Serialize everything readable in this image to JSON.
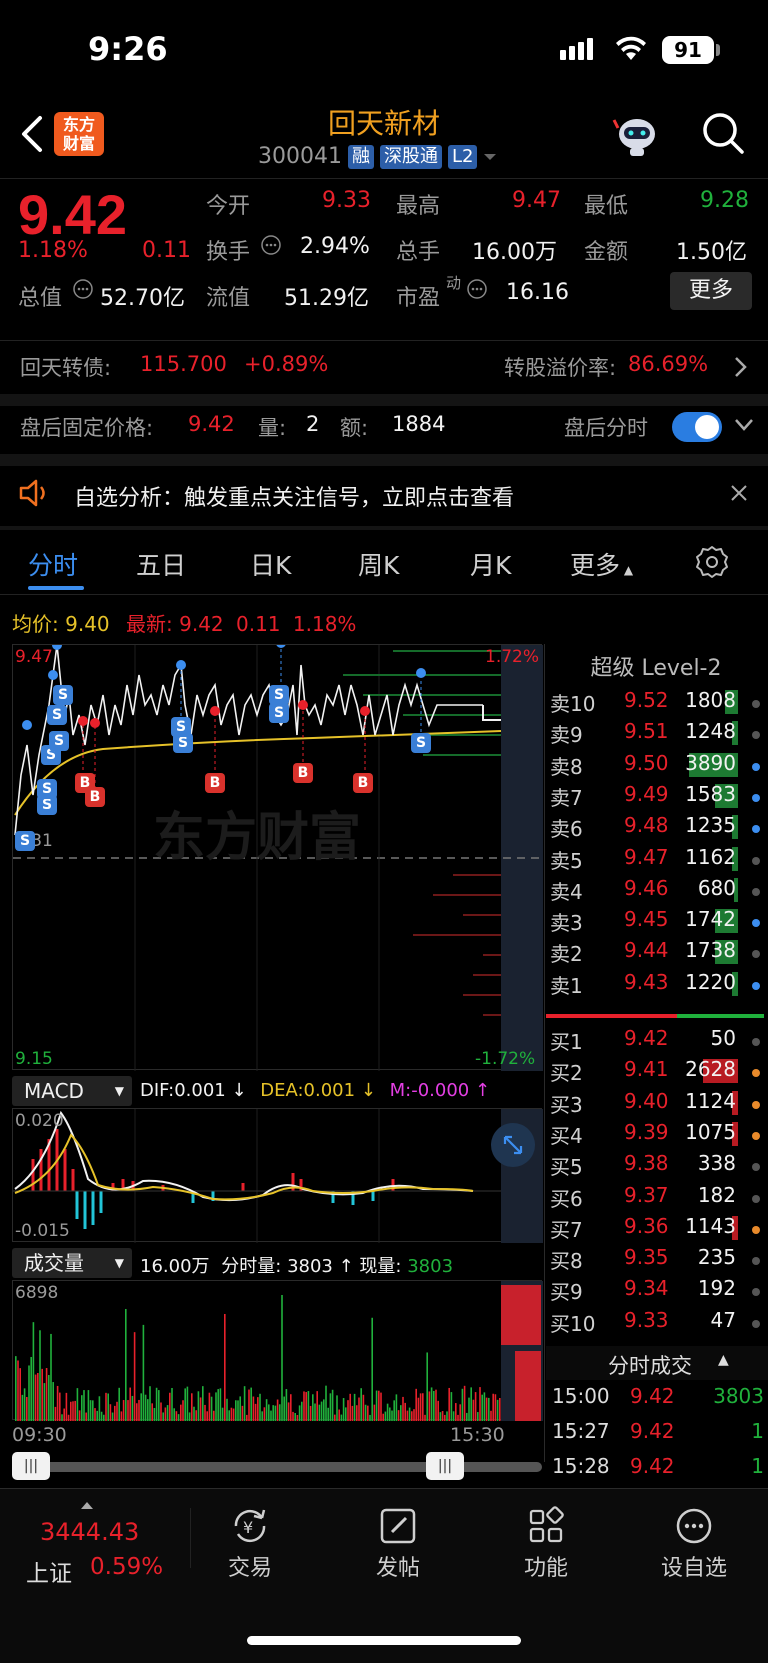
{
  "status": {
    "time": "9:26",
    "battery": "91"
  },
  "header": {
    "title": "回天新材",
    "code": "300041",
    "tags": [
      "融",
      "深股通",
      "L2"
    ],
    "logo_line1": "东方",
    "logo_line2": "财富"
  },
  "quote": {
    "price": "9.42",
    "change_pct": "1.18%",
    "change": "0.11",
    "open_label": "今开",
    "open": "9.33",
    "high_label": "最高",
    "high": "9.47",
    "low_label": "最低",
    "low": "9.28",
    "turnover_label": "换手",
    "turnover": "2.94%",
    "volume_label": "总手",
    "volume": "16.00万",
    "amount_label": "金额",
    "amount": "1.50亿",
    "mktcap_label": "总值",
    "mktcap": "52.70亿",
    "float_label": "流值",
    "float": "51.29亿",
    "pe_label": "市盈",
    "pe_sup": "动",
    "pe": "16.16",
    "more": "更多"
  },
  "bond": {
    "label": "回天转债:",
    "price": "115.700",
    "change": "+0.89%",
    "premium_label": "转股溢价率:",
    "premium": "86.69%"
  },
  "afterhours": {
    "label": "盘后固定价格:",
    "price": "9.42",
    "vol_label": "量:",
    "vol": "2",
    "amt_label": "额:",
    "amt": "1884",
    "toggle_label": "盘后分时",
    "toggle_on": true
  },
  "notice": {
    "text": "自选分析：触发重点关注信号，立即点击查看"
  },
  "tabs": [
    "分时",
    "五日",
    "日K",
    "周K",
    "月K",
    "更多"
  ],
  "intraday": {
    "avg_label": "均价:",
    "avg": "9.40",
    "latest_label": "最新:",
    "latest": "9.42",
    "latest_change": "0.11",
    "latest_pct": "1.18%",
    "y_top": "9.47",
    "y_mid": "9.31",
    "y_bottom": "9.15",
    "pct_top": "1.72%",
    "pct_bottom": "-1.72%",
    "watermark": "东方财富",
    "signals": [
      {
        "type": "S",
        "count": 1
      },
      {
        "type": "S",
        "count": 2
      },
      {
        "type": "S",
        "count": 3
      },
      {
        "type": "S",
        "count": 4
      },
      {
        "type": "B",
        "count": 1
      },
      {
        "type": "B",
        "count": 2
      },
      {
        "type": "B",
        "count": 3
      },
      {
        "type": "B",
        "count": 4
      },
      {
        "type": "B",
        "count": 5
      },
      {
        "type": "S",
        "count": 5
      },
      {
        "type": "S",
        "count": 6
      },
      {
        "type": "S",
        "count": 7
      }
    ]
  },
  "macd": {
    "label": "MACD",
    "dif": "DIF:0.001",
    "dea": "DEA:0.001",
    "m": "M:-0.000",
    "y_top": "0.020",
    "y_bottom": "-0.015"
  },
  "volume_panel": {
    "label": "成交量",
    "total": "16.00万",
    "minute_label": "分时量:",
    "minute": "3803",
    "now_label": "现量:",
    "now": "3803",
    "y_top": "6898",
    "time_start": "09:30",
    "time_end": "15:30"
  },
  "level2": {
    "title": "超级 Level-2",
    "asks": [
      {
        "label": "卖10",
        "price": "9.52",
        "vol": "1808",
        "fill": 0.25,
        "dot": "#555"
      },
      {
        "label": "卖9",
        "price": "9.51",
        "vol": "1248",
        "fill": 0.12,
        "dot": "#555"
      },
      {
        "label": "卖8",
        "price": "9.50",
        "vol": "3890",
        "fill": 0.95,
        "dot": "#3c8ef0"
      },
      {
        "label": "卖7",
        "price": "9.49",
        "vol": "1583",
        "fill": 0.45,
        "dot": "#3c8ef0"
      },
      {
        "label": "卖6",
        "price": "9.48",
        "vol": "1235",
        "fill": 0.12,
        "dot": "#3c8ef0"
      },
      {
        "label": "卖5",
        "price": "9.47",
        "vol": "1162",
        "fill": 0.12,
        "dot": "#555"
      },
      {
        "label": "卖4",
        "price": "9.46",
        "vol": "680",
        "fill": 0.08,
        "dot": "#555"
      },
      {
        "label": "卖3",
        "price": "9.45",
        "vol": "1742",
        "fill": 0.45,
        "dot": "#3c8ef0"
      },
      {
        "label": "卖2",
        "price": "9.44",
        "vol": "1738",
        "fill": 0.45,
        "dot": "#555"
      },
      {
        "label": "卖1",
        "price": "9.43",
        "vol": "1220",
        "fill": 0.12,
        "dot": "#3c8ef0"
      }
    ],
    "bids": [
      {
        "label": "买1",
        "price": "9.42",
        "vol": "50",
        "fill": 0.0,
        "dot": "#555"
      },
      {
        "label": "买2",
        "price": "9.41",
        "vol": "2628",
        "fill": 0.68,
        "dot": "#e88a2b"
      },
      {
        "label": "买3",
        "price": "9.40",
        "vol": "1124",
        "fill": 0.12,
        "dot": "#e88a2b"
      },
      {
        "label": "买4",
        "price": "9.39",
        "vol": "1075",
        "fill": 0.12,
        "dot": "#e88a2b"
      },
      {
        "label": "买5",
        "price": "9.38",
        "vol": "338",
        "fill": 0.0,
        "dot": "#555"
      },
      {
        "label": "买6",
        "price": "9.37",
        "vol": "182",
        "fill": 0.0,
        "dot": "#555"
      },
      {
        "label": "买7",
        "price": "9.36",
        "vol": "1143",
        "fill": 0.12,
        "dot": "#e88a2b"
      },
      {
        "label": "买8",
        "price": "9.35",
        "vol": "235",
        "fill": 0.0,
        "dot": "#555"
      },
      {
        "label": "买9",
        "price": "9.34",
        "vol": "192",
        "fill": 0.0,
        "dot": "#555"
      },
      {
        "label": "买10",
        "price": "9.33",
        "vol": "47",
        "fill": 0.0,
        "dot": "#555"
      }
    ],
    "trades_title": "分时成交",
    "trades": [
      {
        "time": "15:00",
        "price": "9.42",
        "vol": "3803"
      },
      {
        "time": "15:27",
        "price": "9.42",
        "vol": "1"
      },
      {
        "time": "15:28",
        "price": "9.42",
        "vol": "1"
      }
    ]
  },
  "bottom": {
    "index_value": "3444.43",
    "index_name": "上证",
    "index_pct": "0.59%",
    "items": [
      "交易",
      "发帖",
      "功能",
      "设自选"
    ]
  },
  "colors": {
    "up": "#e8212b",
    "down": "#20b13c",
    "accent": "#3c8ef0",
    "avg_line": "#e6c229",
    "brand": "#f0a020"
  }
}
